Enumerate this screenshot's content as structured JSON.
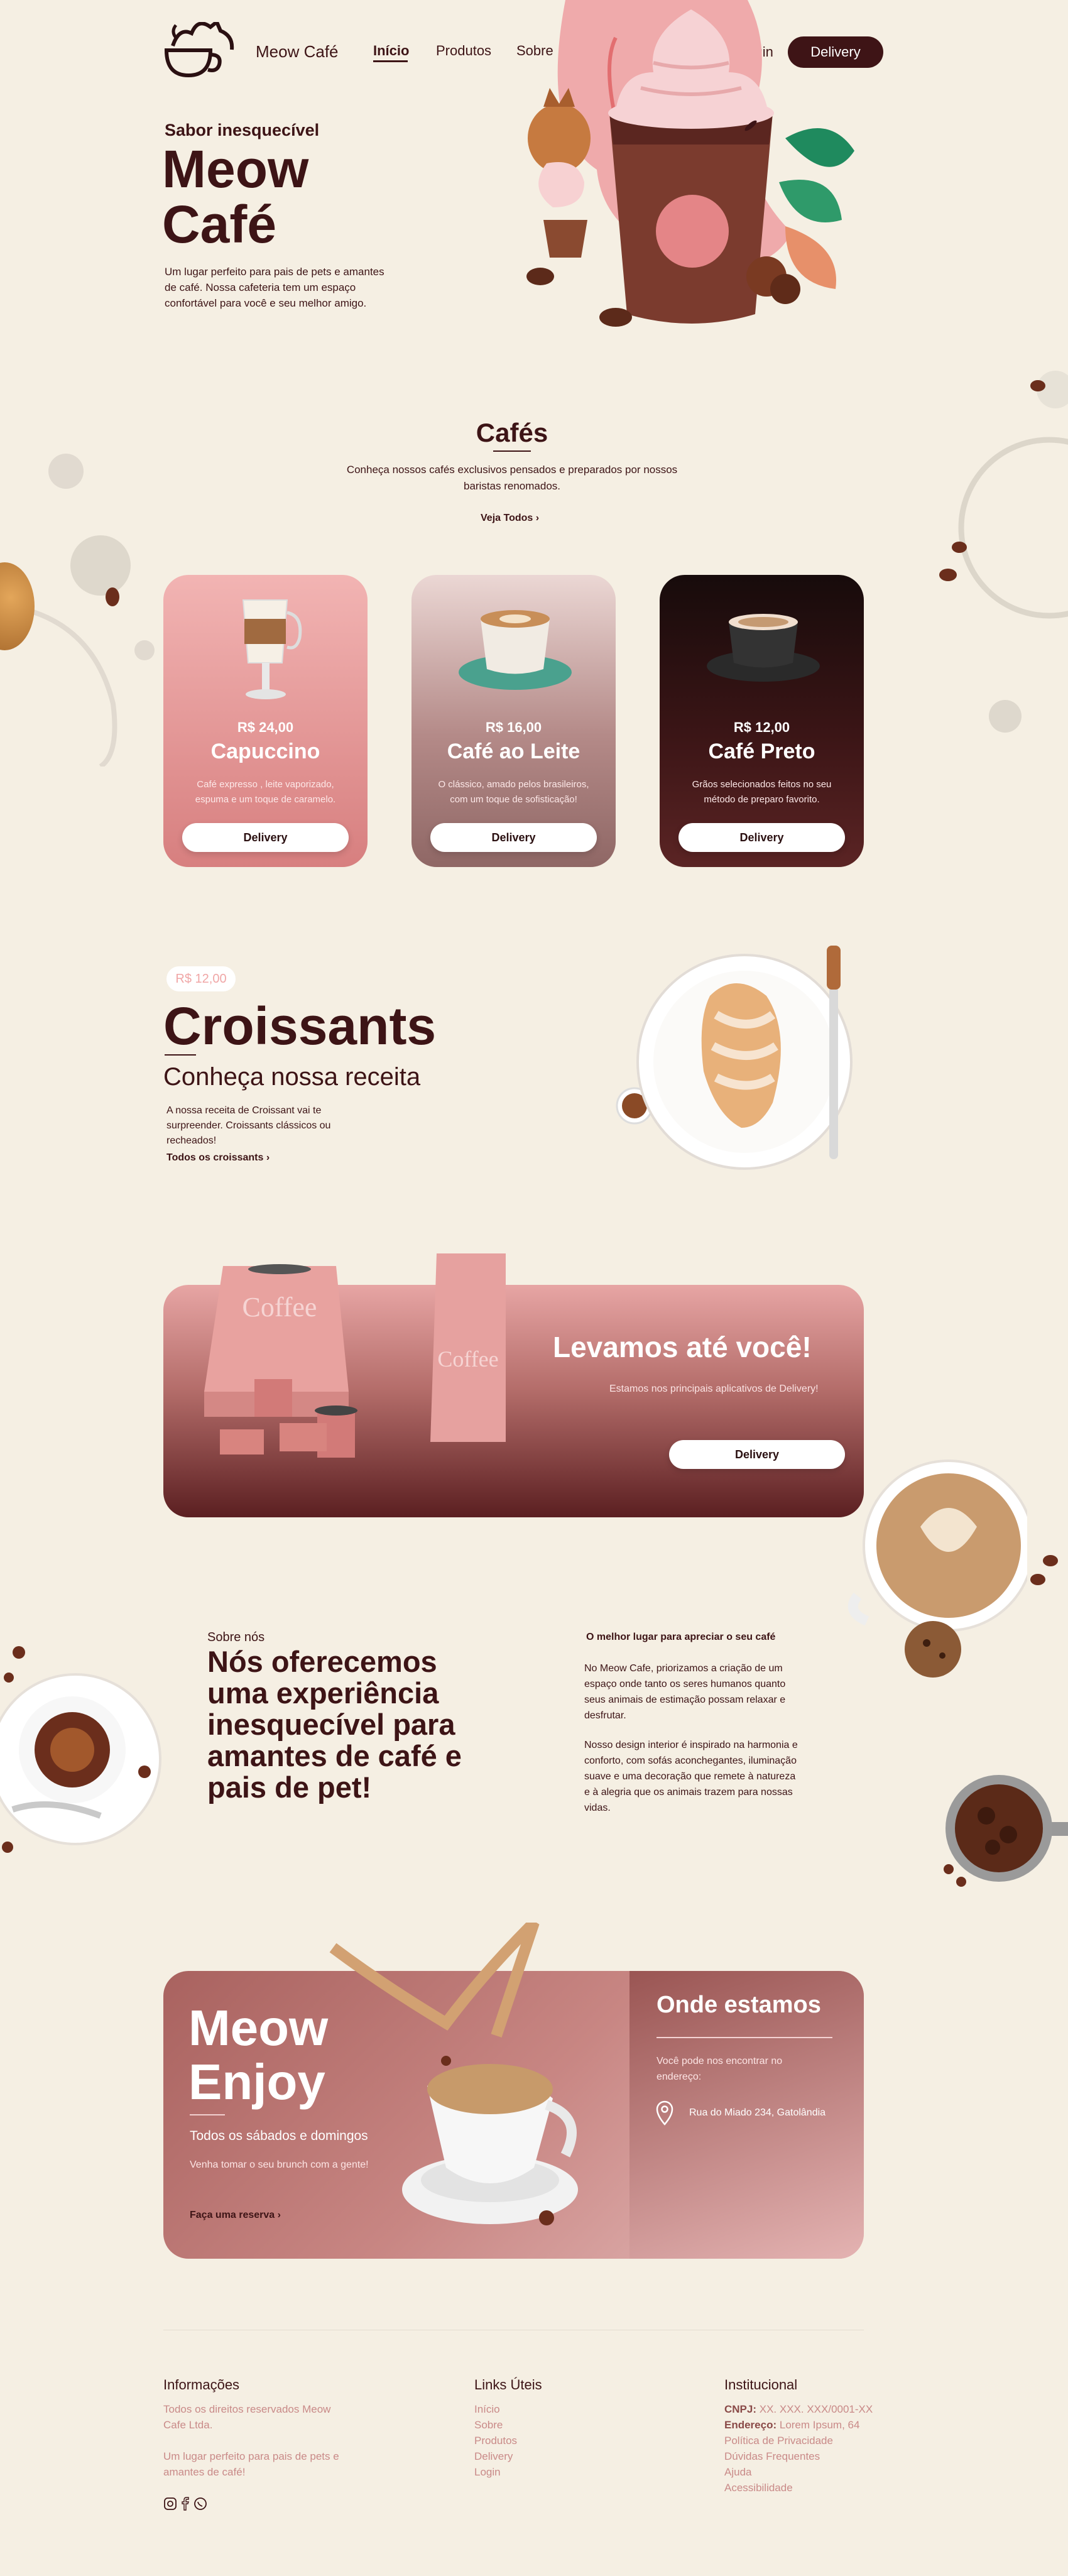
{
  "header": {
    "brand": "Meow Café",
    "nav": [
      "Início",
      "Produtos",
      "Sobre"
    ],
    "login": "Login",
    "delivery": "Delivery"
  },
  "hero": {
    "kicker": "Sabor inesquecível",
    "title_line1": "Meow",
    "title_line2": "Café",
    "description": "Um lugar perfeito para pais de pets e amantes de café. Nossa cafeteria tem um espaço confortável para você e seu melhor amigo."
  },
  "cafes": {
    "title": "Cafés",
    "subtitle": "Conheça nossos cafés exclusivos pensados e preparados por nossos baristas renomados.",
    "see_all": "Veja Todos ›",
    "cards": [
      {
        "price": "R$ 24,00",
        "name": "Capuccino",
        "desc": "Café expresso , leite vaporizado, espuma e um toque de caramelo.",
        "button": "Delivery"
      },
      {
        "price": "R$ 16,00",
        "name": "Café ao Leite",
        "desc": "O clássico, amado pelos brasileiros, com um toque de sofisticação!",
        "button": "Delivery"
      },
      {
        "price": "R$ 12,00",
        "name": "Café Preto",
        "desc": "Grãos selecionados feitos no seu método de preparo favorito.",
        "button": "Delivery"
      }
    ]
  },
  "croissants": {
    "price_badge": "R$ 12,00",
    "title": "Croissants",
    "subtitle": "Conheça nossa receita",
    "description": "A nossa receita de Croissant vai te surpreender. Croissants clássicos ou recheados!",
    "link": "Todos os croissants ›"
  },
  "delivery_banner": {
    "title": "Levamos até você!",
    "subtitle": "Estamos nos principais aplicativos de Delivery!",
    "button": "Delivery",
    "bag_label": "Coffee"
  },
  "about": {
    "kicker": "Sobre nós",
    "title": "Nós oferecemos uma experiência inesquecível para amantes de café e pais de pet!",
    "right_title": "O melhor lugar para apreciar o seu café",
    "p1": "No Meow Cafe, priorizamos a criação de um espaço onde tanto os seres humanos quanto seus animais de estimação possam relaxar e desfrutar.",
    "p2": "Nosso design interior é inspirado na harmonia e conforto, com sofás aconchegantes, iluminação suave e uma decoração que remete à natureza e à alegria que os animais trazem para nossas vidas."
  },
  "enjoy": {
    "title_line1": "Meow",
    "title_line2": "Enjoy",
    "schedule": "Todos os sábados e domingos",
    "invite": "Venha tomar o seu brunch com a gente!",
    "link": "Faça uma reserva ›",
    "where_title": "Onde estamos",
    "where_text": "Você pode nos encontrar no endereço:",
    "address": "Rua do Miado 234, Gatolândia"
  },
  "footer": {
    "info_title": "Informações",
    "info_text1": "Todos os direitos reservados Meow Cafe Ltda.",
    "info_text2": "Um lugar perfeito para pais de pets e amantes de café!",
    "links_title": "Links Úteis",
    "links": [
      "Início",
      "Sobre",
      "Produtos",
      "Delivery",
      "Login"
    ],
    "inst_title": "Institucional",
    "cnpj_label": "CNPJ:",
    "cnpj_value": " XX. XXX. XXX/0001-XX",
    "address_label": "Endereço:",
    "address_value": " Lorem Ipsum, 64",
    "inst_links": [
      "Política de Privacidade",
      "Dúvidas Frequentes",
      "Ajuda",
      "Acessibilidade"
    ]
  }
}
